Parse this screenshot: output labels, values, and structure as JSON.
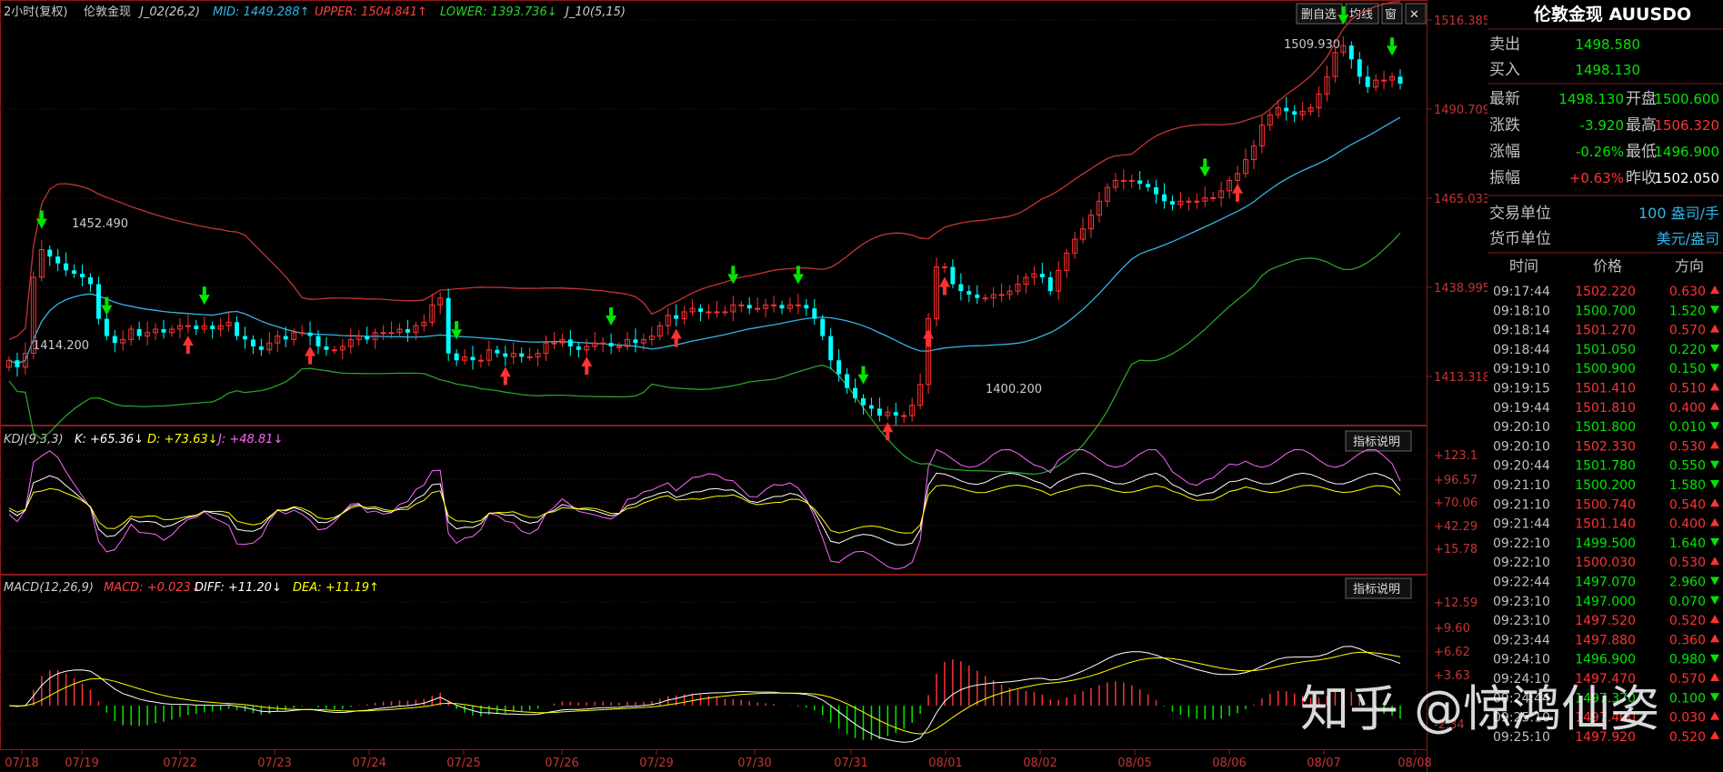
{
  "header": {
    "period": "2小时(复权)",
    "instrument": "伦敦金现",
    "ind_name": "J_02(26,2)",
    "mid": "MID: 1449.288↑",
    "upper": "UPPER: 1504.841↑",
    "lower": "LOWER: 1393.736↓",
    "j10": "J_10(5,15)",
    "buttons": [
      "删自选",
      "均线",
      "窗",
      "✕"
    ]
  },
  "kdj": {
    "name": "KDJ(9,3,3)",
    "k": "K: +65.36↓",
    "d": "D: +73.63↓",
    "j": "J: +48.81↓",
    "explain": "指标说明"
  },
  "macd": {
    "name": "MACD(12,26,9)",
    "macd": "MACD: +0.023↓",
    "diff": "DIFF: +11.20↓",
    "dea": "DEA: +11.19↑",
    "explain": "指标说明"
  },
  "axes": {
    "price_ticks": [
      "1516.385",
      "1490.709",
      "1465.033",
      "1438.995",
      "1413.318"
    ],
    "kdj_ticks": [
      "+123.1",
      "+96.57",
      "+70.06",
      "+42.29",
      "+15.78"
    ],
    "macd_ticks": [
      "+12.59",
      "+9.60",
      "+6.62",
      "+3.63",
      "-2.34"
    ],
    "dates": [
      "07/18",
      "07/19",
      "07/22",
      "07/23",
      "07/24",
      "07/25",
      "07/26",
      "07/29",
      "07/30",
      "07/31",
      "08/01",
      "08/02",
      "08/05",
      "08/06",
      "08/07",
      "08/08"
    ]
  },
  "annotations": {
    "high": "1509.930",
    "peak": "1452.490",
    "low1": "1414.200",
    "low2": "1400.200"
  },
  "panel": {
    "title": "伦敦金现 AUUSDO",
    "sell_label": "卖出",
    "sell": "1498.580",
    "buy_label": "买入",
    "buy": "1498.130",
    "rows": [
      {
        "l1": "最新",
        "v1": "1498.130",
        "l2": "开盘",
        "v2": "1500.600"
      },
      {
        "l1": "涨跌",
        "v1": "-3.920",
        "l2": "最高",
        "v2": "1506.320"
      },
      {
        "l1": "涨幅",
        "v1": "-0.26%",
        "l2": "最低",
        "v2": "1496.900"
      },
      {
        "l1": "振幅",
        "v1": "+0.63%",
        "l2": "昨收",
        "v2": "1502.050"
      }
    ],
    "unit_label": "交易单位",
    "unit_value": "100 盎司/手",
    "cur_label": "货币单位",
    "cur_value": "美元/盎司",
    "tick_headers": [
      "时间",
      "价格",
      "方向"
    ],
    "ticks": [
      {
        "t": "09:17:44",
        "p": "1502.220",
        "c": "0.630",
        "d": "up"
      },
      {
        "t": "09:18:10",
        "p": "1500.700",
        "c": "1.520",
        "d": "down"
      },
      {
        "t": "09:18:14",
        "p": "1501.270",
        "c": "0.570",
        "d": "up"
      },
      {
        "t": "09:18:44",
        "p": "1501.050",
        "c": "0.220",
        "d": "down"
      },
      {
        "t": "09:19:10",
        "p": "1500.900",
        "c": "0.150",
        "d": "down"
      },
      {
        "t": "09:19:15",
        "p": "1501.410",
        "c": "0.510",
        "d": "up"
      },
      {
        "t": "09:19:44",
        "p": "1501.810",
        "c": "0.400",
        "d": "up"
      },
      {
        "t": "09:20:10",
        "p": "1501.800",
        "c": "0.010",
        "d": "down"
      },
      {
        "t": "09:20:10",
        "p": "1502.330",
        "c": "0.530",
        "d": "up"
      },
      {
        "t": "09:20:44",
        "p": "1501.780",
        "c": "0.550",
        "d": "down"
      },
      {
        "t": "09:21:10",
        "p": "1500.200",
        "c": "1.580",
        "d": "down"
      },
      {
        "t": "09:21:10",
        "p": "1500.740",
        "c": "0.540",
        "d": "up"
      },
      {
        "t": "09:21:44",
        "p": "1501.140",
        "c": "0.400",
        "d": "up"
      },
      {
        "t": "09:22:10",
        "p": "1499.500",
        "c": "1.640",
        "d": "down"
      },
      {
        "t": "09:22:10",
        "p": "1500.030",
        "c": "0.530",
        "d": "up"
      },
      {
        "t": "09:22:44",
        "p": "1497.070",
        "c": "2.960",
        "d": "down"
      },
      {
        "t": "09:23:10",
        "p": "1497.000",
        "c": "0.070",
        "d": "down"
      },
      {
        "t": "09:23:10",
        "p": "1497.520",
        "c": "0.520",
        "d": "up"
      },
      {
        "t": "09:23:44",
        "p": "1497.880",
        "c": "0.360",
        "d": "up"
      },
      {
        "t": "09:24:10",
        "p": "1496.900",
        "c": "0.980",
        "d": "down"
      },
      {
        "t": "09:24:10",
        "p": "1497.470",
        "c": "0.570",
        "d": "up"
      },
      {
        "t": "09:24:44",
        "p": "1497.370",
        "c": "0.100",
        "d": "down"
      },
      {
        "t": "09:25:10",
        "p": "1497.400",
        "c": "0.030",
        "d": "up"
      },
      {
        "t": "09:25:10",
        "p": "1497.920",
        "c": "0.520",
        "d": "up"
      }
    ]
  },
  "watermark": "知乎 @惊鸿仙姿",
  "colors": {
    "up": "#ff3232",
    "down": "#00ffff",
    "mid": "#33b5e5",
    "upper": "#c43434",
    "lower": "#2aa02a",
    "green": "#00e600",
    "yellow": "#ffff00",
    "panel_text": "#c0c0c0"
  },
  "chart_data": [
    {
      "type": "candlestick",
      "title": "伦敦金现 2小时(复权)",
      "x": [
        "07/18",
        "07/18",
        "07/18",
        "07/18",
        "07/19",
        "07/19",
        "07/19",
        "07/19",
        "07/19",
        "07/19",
        "07/19",
        "07/19",
        "07/19",
        "07/19",
        "07/19",
        "07/19",
        "07/22",
        "07/22",
        "07/22",
        "07/22",
        "07/22",
        "07/22",
        "07/22",
        "07/22",
        "07/22",
        "07/22",
        "07/22",
        "07/22",
        "07/23",
        "07/23",
        "07/23",
        "07/23",
        "07/23",
        "07/23",
        "07/23",
        "07/23",
        "07/23",
        "07/23",
        "07/23",
        "07/23",
        "07/24",
        "07/24",
        "07/24",
        "07/24",
        "07/24",
        "07/24",
        "07/24",
        "07/24",
        "07/24",
        "07/24",
        "07/24",
        "07/24",
        "07/25",
        "07/25",
        "07/25",
        "07/25",
        "07/25",
        "07/25",
        "07/25",
        "07/25",
        "07/25",
        "07/25",
        "07/25",
        "07/25",
        "07/26",
        "07/26",
        "07/26",
        "07/26",
        "07/26",
        "07/26",
        "07/26",
        "07/26",
        "07/26",
        "07/26",
        "07/26",
        "07/26",
        "07/29",
        "07/29",
        "07/29",
        "07/29",
        "07/29",
        "07/29",
        "07/29",
        "07/29",
        "07/29",
        "07/29",
        "07/29",
        "07/29",
        "07/30",
        "07/30",
        "07/30",
        "07/30",
        "07/30",
        "07/30",
        "07/30",
        "07/30",
        "07/30",
        "07/30",
        "07/30",
        "07/30",
        "07/31",
        "07/31",
        "07/31",
        "07/31",
        "07/31",
        "07/31",
        "07/31",
        "07/31",
        "07/31",
        "07/31",
        "07/31",
        "07/31",
        "08/01",
        "08/01",
        "08/01",
        "08/01",
        "08/01",
        "08/01",
        "08/01",
        "08/01",
        "08/01",
        "08/01",
        "08/01",
        "08/01",
        "08/02",
        "08/02",
        "08/02",
        "08/02",
        "08/02",
        "08/02",
        "08/02",
        "08/02",
        "08/02",
        "08/02",
        "08/02",
        "08/02",
        "08/05",
        "08/05",
        "08/05",
        "08/05",
        "08/05",
        "08/05",
        "08/05",
        "08/05",
        "08/05",
        "08/05",
        "08/05",
        "08/05",
        "08/06",
        "08/06",
        "08/06",
        "08/06",
        "08/06",
        "08/06",
        "08/06",
        "08/06",
        "08/06",
        "08/06",
        "08/06",
        "08/06",
        "08/07",
        "08/07",
        "08/07",
        "08/07",
        "08/07",
        "08/07",
        "08/07",
        "08/07",
        "08/07",
        "08/07",
        "08/07",
        "08/07",
        "08/08",
        "08/08"
      ],
      "close": [
        1418,
        1416,
        1420,
        1442,
        1450,
        1448,
        1446,
        1444,
        1443,
        1442,
        1440,
        1430,
        1425,
        1423,
        1424,
        1427,
        1425,
        1426,
        1427,
        1426,
        1427,
        1428,
        1428,
        1427,
        1428,
        1427,
        1428,
        1429,
        1425,
        1424,
        1422,
        1421,
        1423,
        1425,
        1424,
        1426,
        1426,
        1425,
        1422,
        1421,
        1421,
        1422,
        1424,
        1425,
        1424,
        1426,
        1426,
        1426,
        1427,
        1426,
        1428,
        1429,
        1434,
        1436,
        1420,
        1418,
        1419,
        1418,
        1418,
        1421,
        1420,
        1419,
        1420,
        1419,
        1419,
        1420,
        1423,
        1423,
        1424,
        1422,
        1421,
        1422,
        1423,
        1423,
        1422,
        1422,
        1424,
        1423,
        1424,
        1425,
        1428,
        1431,
        1430,
        1432,
        1433,
        1432,
        1432,
        1432,
        1432,
        1434,
        1434,
        1433,
        1433,
        1434,
        1434,
        1433,
        1434,
        1434,
        1433,
        1430,
        1425,
        1418,
        1414,
        1410,
        1407,
        1405,
        1404,
        1402,
        1403,
        1402,
        1402,
        1405,
        1411,
        1430,
        1445,
        1445,
        1440,
        1438,
        1437,
        1436,
        1436,
        1437,
        1437,
        1438,
        1440,
        1442,
        1443,
        1442,
        1438,
        1444,
        1449,
        1453,
        1456,
        1460,
        1464,
        1468,
        1470,
        1470,
        1470,
        1469,
        1468,
        1466,
        1464,
        1463,
        1464,
        1464,
        1464,
        1465,
        1465,
        1467,
        1470,
        1472,
        1476,
        1480,
        1486,
        1489,
        1491,
        1490,
        1489,
        1490,
        1491,
        1495,
        1500,
        1507,
        1509,
        1505,
        1500,
        1497,
        1499,
        1499,
        1500,
        1498
      ]
    },
    {
      "type": "line",
      "title": "KDJ(9,3,3)",
      "series": [
        {
          "name": "K",
          "values": [
            65.36
          ]
        },
        {
          "name": "D",
          "values": [
            73.63
          ]
        },
        {
          "name": "J",
          "values": [
            48.81
          ]
        }
      ]
    },
    {
      "type": "bar",
      "title": "MACD(12,26,9)",
      "series": [
        {
          "name": "MACD",
          "values": [
            0.023
          ]
        },
        {
          "name": "DIFF",
          "values": [
            11.2
          ]
        },
        {
          "name": "DEA",
          "values": [
            11.19
          ]
        }
      ]
    }
  ]
}
